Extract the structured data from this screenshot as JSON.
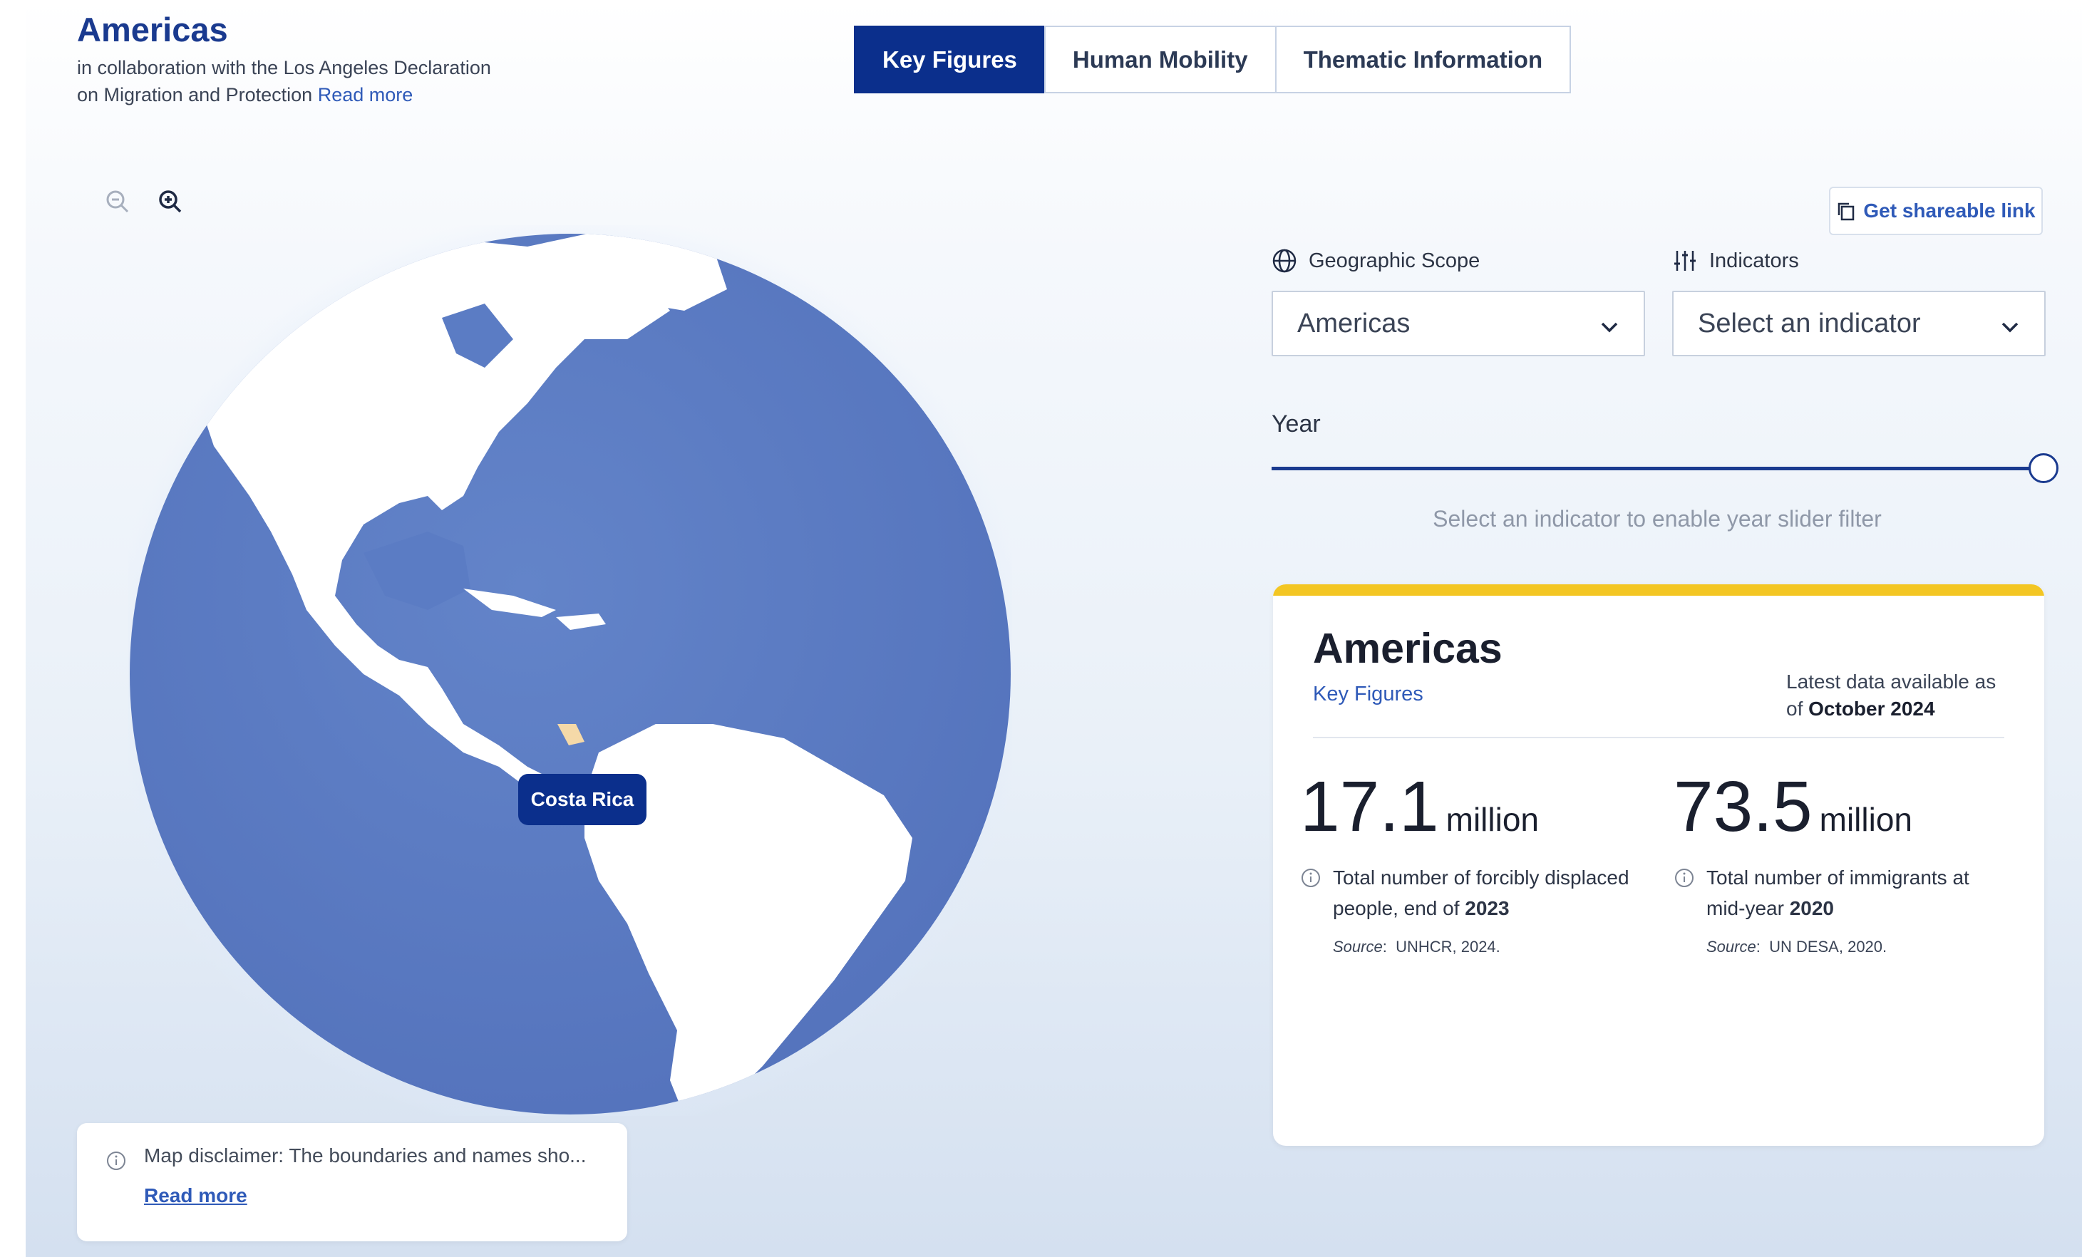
{
  "header": {
    "title": "Americas",
    "subtitle_line1": "in collaboration with the Los Angeles Declaration",
    "subtitle_line2": "on Migration and Protection",
    "read_more": "Read more"
  },
  "tabs": [
    {
      "label": "Key Figures",
      "active": true
    },
    {
      "label": "Human Mobility",
      "active": false
    },
    {
      "label": "Thematic Information",
      "active": false
    }
  ],
  "map": {
    "highlighted_country": "Costa Rica",
    "disclaimer": "Map disclaimer: The boundaries and names sho...",
    "disclaimer_link": "Read more"
  },
  "controls": {
    "share_label": "Get shareable link",
    "geo_scope_label": "Geographic Scope",
    "geo_scope_value": "Americas",
    "indicators_label": "Indicators",
    "indicators_placeholder": "Select an indicator",
    "year_label": "Year",
    "year_slider_position": 1.0,
    "year_hint": "Select an indicator to enable year slider filter"
  },
  "card": {
    "title": "Americas",
    "subtitle": "Key Figures",
    "date_prefix": "Latest data available as of",
    "date_value": "October 2024",
    "figures": [
      {
        "value": "17.1",
        "unit": "million",
        "desc": "Total number of forcibly displaced people, end of",
        "year": "2023",
        "source_label": "Source",
        "source": "UNHCR, 2024."
      },
      {
        "value": "73.5",
        "unit": "million",
        "desc": "Total number of immigrants at mid-year",
        "year": "2020",
        "source_label": "Source",
        "source": "UN DESA, 2020."
      }
    ]
  },
  "colors": {
    "primary": "#0b2f8c",
    "link": "#2f5ab8",
    "ocean": "#5b7cc4",
    "accent_bar": "#f3c623",
    "highlight_country": "#f5d9a8"
  }
}
